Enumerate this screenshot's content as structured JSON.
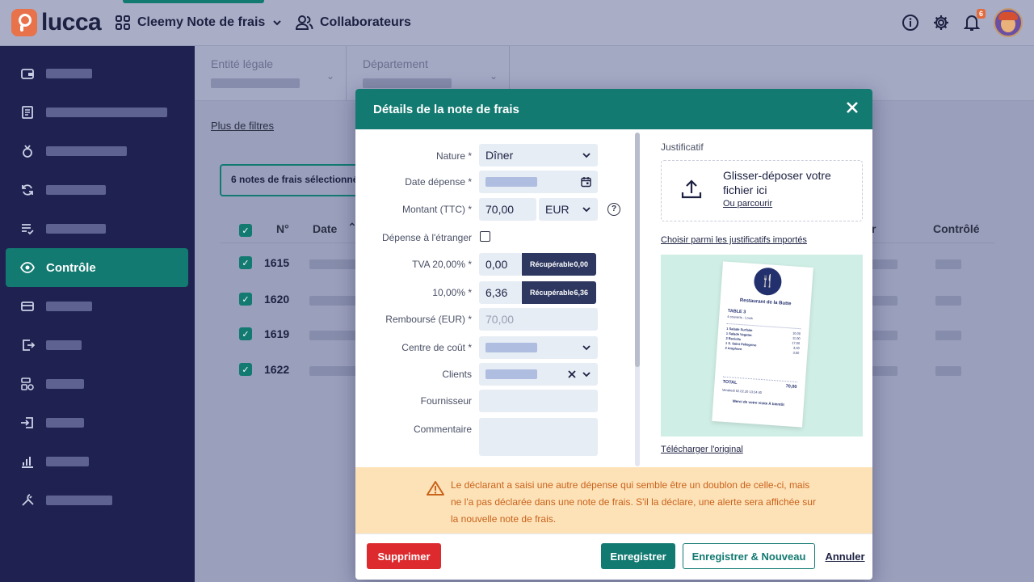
{
  "topbar": {
    "logo": "lucca",
    "app_name": "Cleemy Note de frais",
    "collab_label": "Collaborateurs",
    "notif_count": "6",
    "icons": [
      "info-icon",
      "gear-icon",
      "bell-icon"
    ]
  },
  "sidebar": {
    "items": [
      {
        "icon": "wallet-icon"
      },
      {
        "icon": "receipt-icon"
      },
      {
        "icon": "medal-icon"
      },
      {
        "icon": "sync-icon"
      },
      {
        "icon": "checklist-icon"
      },
      {
        "icon": "eye-icon",
        "label": "Contrôle",
        "active": true
      },
      {
        "icon": "card-icon"
      },
      {
        "icon": "export-icon"
      },
      {
        "icon": "stack-icon"
      },
      {
        "icon": "import-icon"
      },
      {
        "icon": "chart-icon"
      },
      {
        "icon": "tools-icon"
      }
    ]
  },
  "main": {
    "filters": {
      "entity_label": "Entité légale",
      "department_label": "Département",
      "more": "Plus de filtres"
    },
    "selection": "6 notes de frais sélectionnée(s)",
    "columns": {
      "number": "N°",
      "date": "Date",
      "control": "Contrôlé",
      "partial_r": "r"
    },
    "rows": [
      {
        "number": "1615"
      },
      {
        "number": "1620"
      },
      {
        "number": "1619"
      },
      {
        "number": "1622"
      }
    ]
  },
  "modal": {
    "title": "Détails de la note de frais",
    "fields": {
      "nature_label": "Nature *",
      "nature_value": "Dîner",
      "date_label": "Date dépense *",
      "amount_label": "Montant (TTC) *",
      "amount_value": "70,00",
      "currency_value": "EUR",
      "abroad_label": "Dépense à l'étranger",
      "vat20_label": "TVA 20,00% *",
      "vat20_value": "0,00",
      "vat20_recup_label": "Récupérable",
      "vat20_recup_value": "0,00",
      "vat10_label": "10,00% *",
      "vat10_value": "6,36",
      "vat10_recup_label": "Récupérable",
      "vat10_recup_value": "6,36",
      "refund_label": "Remboursé (EUR) *",
      "refund_value": "70,00",
      "cost_center_label": "Centre de coût *",
      "clients_label": "Clients",
      "supplier_label": "Fournisseur",
      "comment_label": "Commentaire"
    },
    "attachment": {
      "label": "Justificatif",
      "drop_title": "Glisser-déposer votre fichier ici",
      "browse": "Ou parcourir",
      "choose": "Choisir parmi les justificatifs importés",
      "download": "Télécharger l'original"
    },
    "receipt": {
      "title": "Restaurant de la Butte",
      "table": "TABLE 3",
      "guests": "4 couverts · Louis",
      "items": [
        {
          "label": "1 Salade Surfaite",
          "price": "10,00"
        },
        {
          "label": "1 Salade Vegetar.",
          "price": "11,00"
        },
        {
          "label": "3 Raviolis",
          "price": "17,00"
        },
        {
          "label": "1 S. Saint Pellegrino",
          "price": "3,00"
        },
        {
          "label": "2 Amphore",
          "price": "3,00"
        }
      ],
      "total_label": "TOTAL",
      "total_value": "70,00",
      "date": "Vendredi 02.02.20 13:24:40",
      "thanks": "Merci de votre visite À bientôt"
    },
    "alert": "Le déclarant a saisi une autre dépense qui semble être un doublon de celle-ci, mais ne l'a pas déclarée dans une note de frais. S'il la déclare, une alerte sera affichée sur la nouvelle note de frais.",
    "buttons": {
      "delete": "Supprimer",
      "save": "Enregistrer",
      "save_new": "Enregistrer & Nouveau",
      "cancel": "Annuler"
    }
  },
  "colors": {
    "primary": "#127a71",
    "sidebar": "#1f2250",
    "danger": "#dd2a2e",
    "warning_bg": "#fde2b8",
    "warning_text": "#c9621a"
  }
}
